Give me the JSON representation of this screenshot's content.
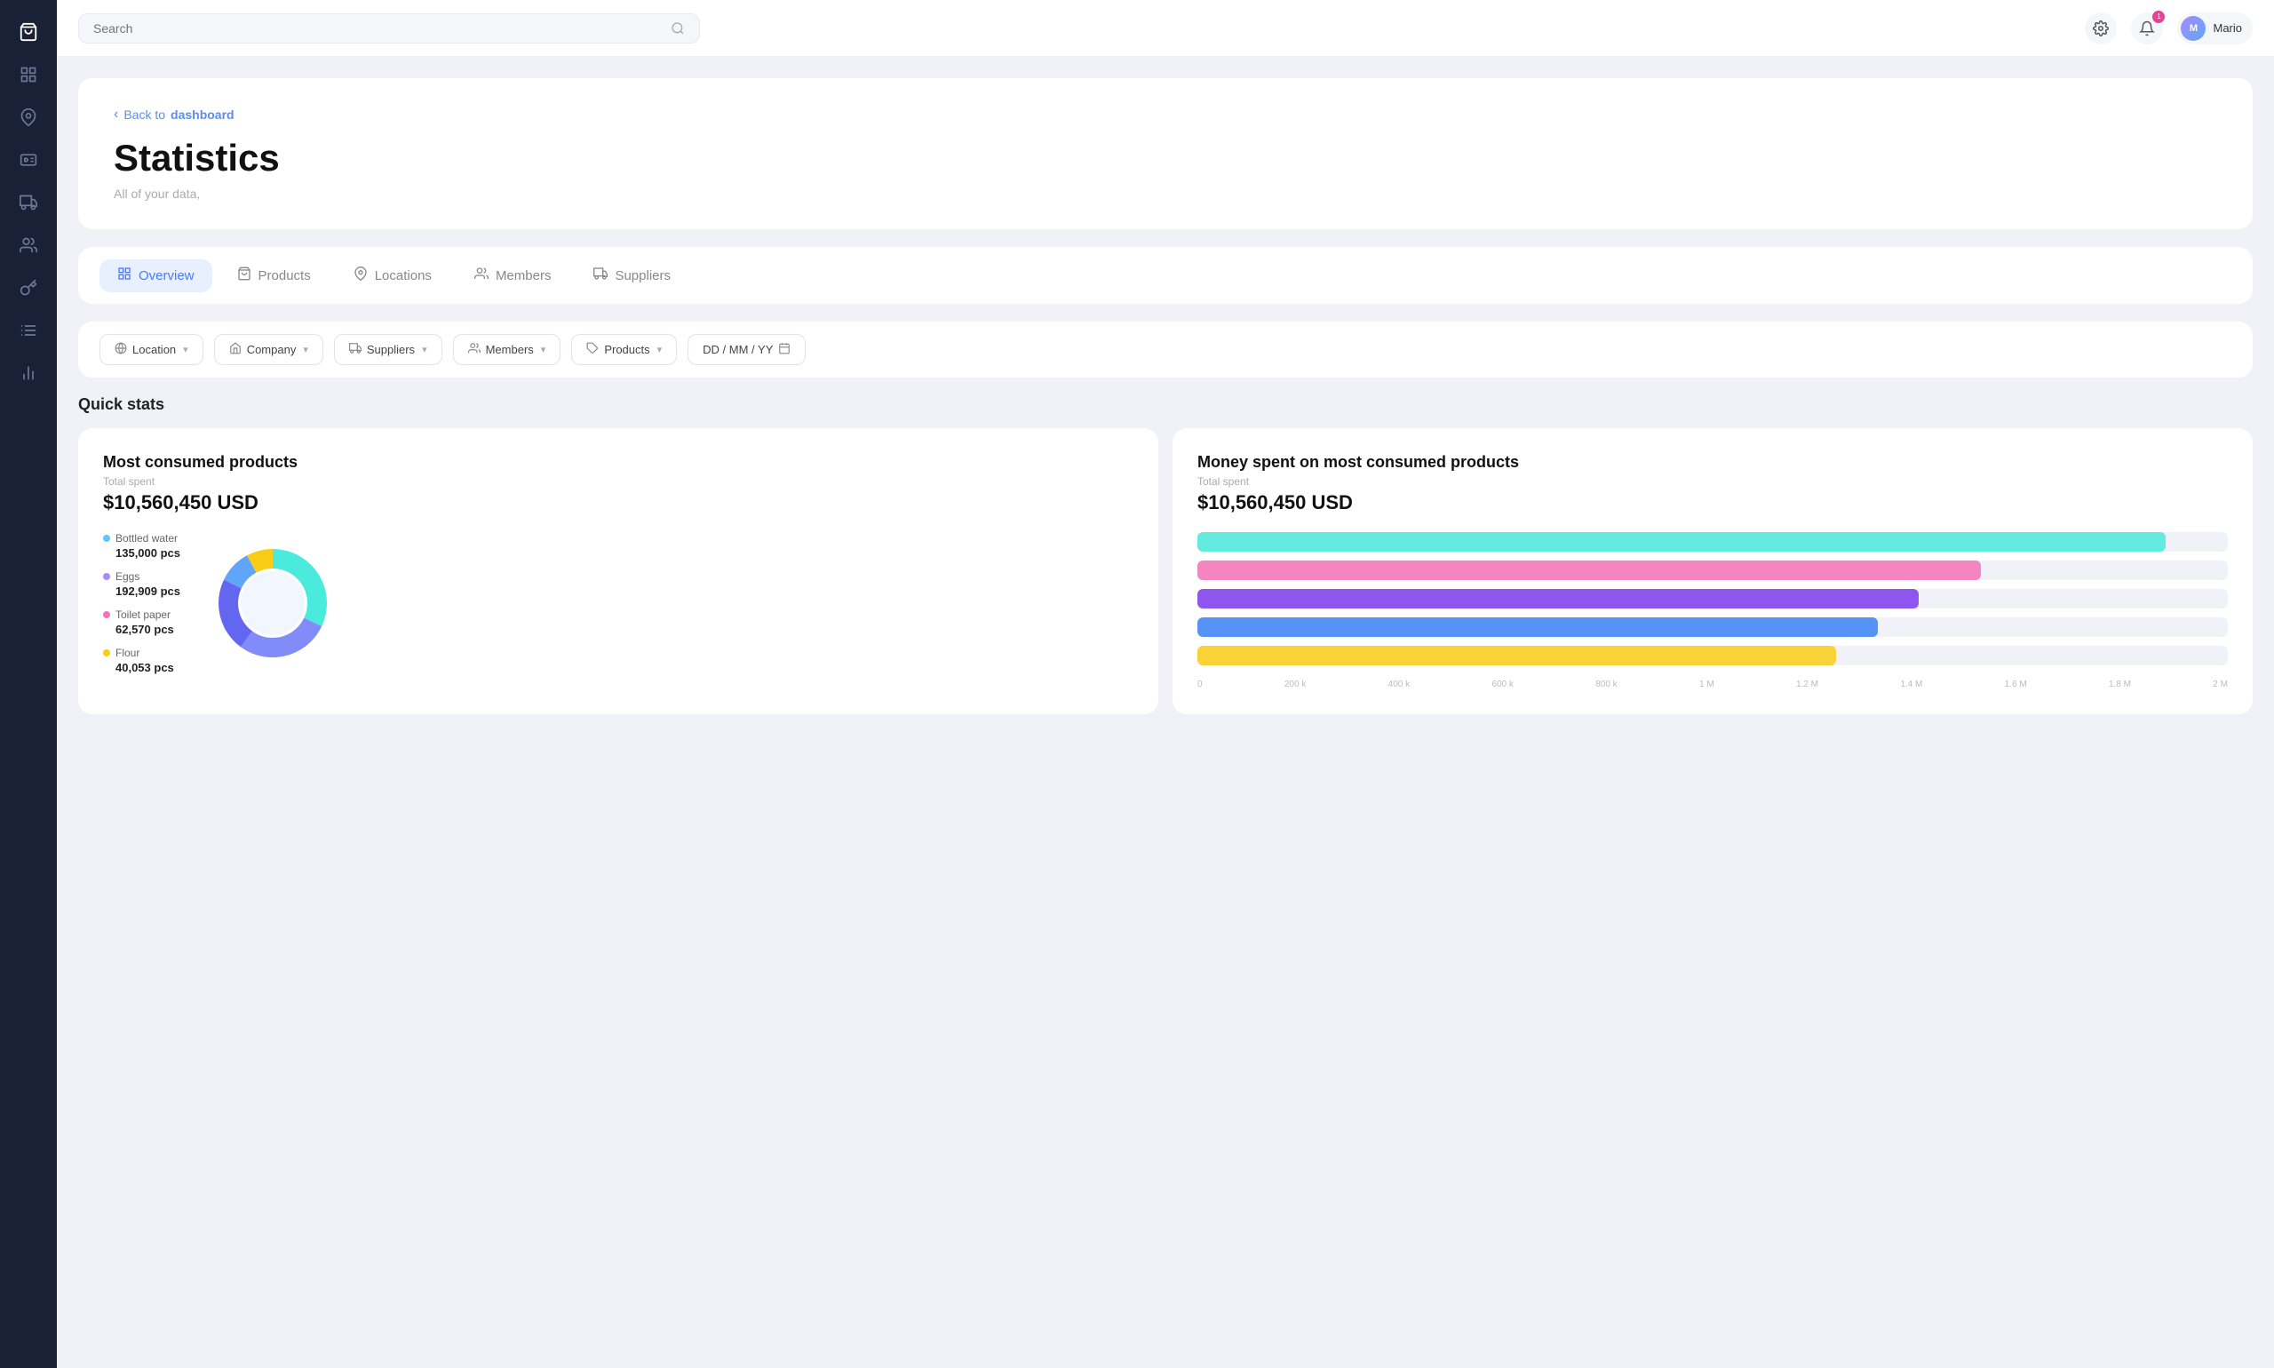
{
  "sidebar": {
    "icons": [
      {
        "name": "shop-icon",
        "symbol": "🛍"
      },
      {
        "name": "home-icon",
        "symbol": "⊞"
      },
      {
        "name": "location-icon",
        "symbol": "📍"
      },
      {
        "name": "id-icon",
        "symbol": "🪪"
      },
      {
        "name": "truck-icon",
        "symbol": "🚚"
      },
      {
        "name": "people-icon",
        "symbol": "👥"
      },
      {
        "name": "key-icon",
        "symbol": "🔑"
      },
      {
        "name": "list-icon",
        "symbol": "📋"
      },
      {
        "name": "chart-icon",
        "symbol": "📊"
      }
    ]
  },
  "header": {
    "search_placeholder": "Search",
    "search_icon": "🔍",
    "settings_icon": "⚙",
    "notifications_icon": "🔔",
    "notification_count": "1",
    "user_name": "Mario",
    "user_initials": "M"
  },
  "hero": {
    "back_link_text": "Back to ",
    "back_link_bold": "dashboard",
    "title": "Statistics",
    "subtitle": "All of your data,"
  },
  "tabs": [
    {
      "id": "overview",
      "label": "Overview",
      "icon": "▦",
      "active": true
    },
    {
      "id": "products",
      "label": "Products",
      "icon": "🛒"
    },
    {
      "id": "locations",
      "label": "Locations",
      "icon": "📍"
    },
    {
      "id": "members",
      "label": "Members",
      "icon": "👥"
    },
    {
      "id": "suppliers",
      "label": "Suppliers",
      "icon": "🚚"
    }
  ],
  "filters": [
    {
      "id": "location",
      "label": "Location",
      "icon": "🌐"
    },
    {
      "id": "company",
      "label": "Company",
      "icon": "🏢"
    },
    {
      "id": "suppliers",
      "label": "Suppliers",
      "icon": "🚛"
    },
    {
      "id": "members",
      "label": "Members",
      "icon": "👥"
    },
    {
      "id": "products",
      "label": "Products",
      "icon": "🎁"
    },
    {
      "id": "date",
      "label": "DD / MM / YY",
      "icon": "📅"
    }
  ],
  "quick_stats": {
    "section_title": "Quick stats",
    "most_consumed": {
      "title": "Most consumed products",
      "label": "Total spent",
      "value": "$10,560,450 USD",
      "legend": [
        {
          "label": "Bottled water",
          "count": "135,000 pcs",
          "color": "#60c4ff"
        },
        {
          "label": "Eggs",
          "count": "192,909 pcs",
          "color": "#a78bfa"
        },
        {
          "label": "Toilet paper",
          "count": "62,570 pcs",
          "color": "#f472b6"
        },
        {
          "label": "Flour",
          "count": "40,053 pcs",
          "color": "#facc15"
        }
      ],
      "donut_segments": [
        {
          "color": "#4aeadc",
          "pct": 32
        },
        {
          "color": "#818cf8",
          "pct": 28
        },
        {
          "color": "#6366f1",
          "pct": 22
        },
        {
          "color": "#60a5fa",
          "pct": 10
        },
        {
          "color": "#facc15",
          "pct": 8
        }
      ]
    },
    "money_spent": {
      "title": "Money spent on most consumed products",
      "label": "Total spent",
      "value": "$10,560,450 USD",
      "bars": [
        {
          "color": "#4aeadc",
          "bg": "#c7faf7",
          "width": 94
        },
        {
          "color": "#f472b6",
          "bg": "#fce7f3",
          "width": 76
        },
        {
          "color": "#7c3aed",
          "bg": "#ede9fe",
          "width": 70
        },
        {
          "color": "#3b82f6",
          "bg": "#dbeafe",
          "width": 66
        },
        {
          "color": "#facc15",
          "bg": "#fef9c3",
          "width": 62
        }
      ],
      "axis_labels": [
        "0",
        "200 k",
        "400 k",
        "600 k",
        "800 k",
        "1 M",
        "1.2 M",
        "1.4 M",
        "1.6 M",
        "1.8 M",
        "2 M"
      ]
    }
  }
}
